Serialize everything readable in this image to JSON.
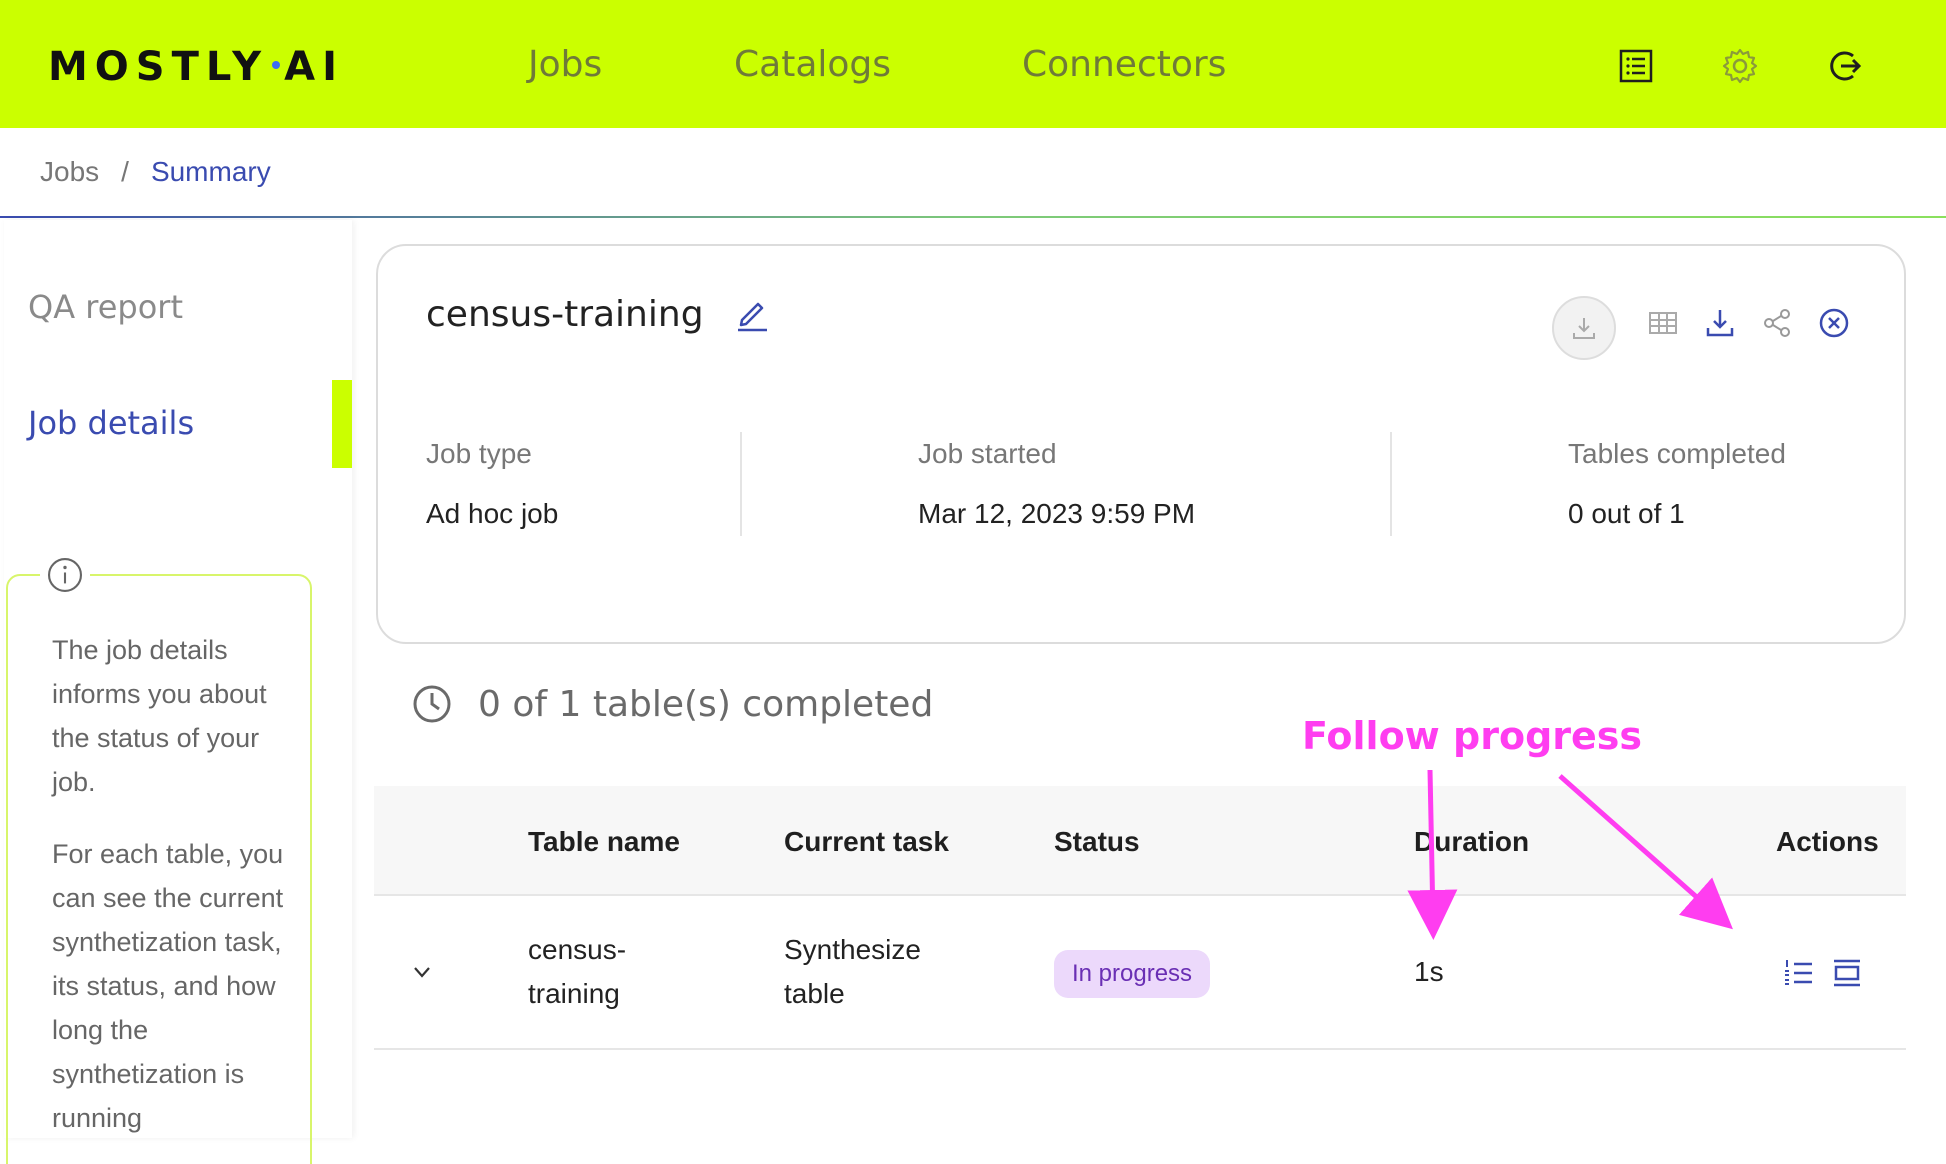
{
  "app": {
    "logo_left": "MOSTLY",
    "logo_right": "AI"
  },
  "nav": {
    "items": [
      {
        "label": "Jobs"
      },
      {
        "label": "Catalogs"
      },
      {
        "label": "Connectors"
      }
    ],
    "icons": [
      "list-icon",
      "gear-icon",
      "logout-icon"
    ]
  },
  "breadcrumb": {
    "parent": "Jobs",
    "separator": "/",
    "current": "Summary"
  },
  "sidebar": {
    "items": [
      {
        "label": "QA report",
        "active": false
      },
      {
        "label": "Job details",
        "active": true
      }
    ],
    "info": {
      "paragraph1": "The job details informs you about the status of your job.",
      "paragraph2": "For each table, you can see the current synthetization task, its status, and how long the synthetization is running"
    }
  },
  "job": {
    "title": "census-training",
    "meta": [
      {
        "label": "Job type",
        "value": "Ad hoc job"
      },
      {
        "label": "Job started",
        "value": "Mar 12, 2023 9:59 PM"
      },
      {
        "label": "Tables completed",
        "value": "0 out of 1"
      }
    ],
    "action_icons": [
      "download-circle-icon",
      "table-icon",
      "download-icon",
      "share-icon",
      "cancel-icon"
    ]
  },
  "progress": {
    "summary": "0 of 1 table(s) completed"
  },
  "annotation": {
    "text": "Follow progress",
    "color": "#ff3df0"
  },
  "table": {
    "columns": [
      "Table name",
      "Current task",
      "Status",
      "Duration",
      "Actions"
    ],
    "rows": [
      {
        "table_name": "census-training",
        "current_task": "Synthesize table",
        "status": "In progress",
        "duration": "1s"
      }
    ]
  },
  "colors": {
    "brand_lime": "#cbff00",
    "accent_blue": "#3a4bb0",
    "status_bg": "#ecd9fb",
    "status_text": "#6a2fb4"
  }
}
